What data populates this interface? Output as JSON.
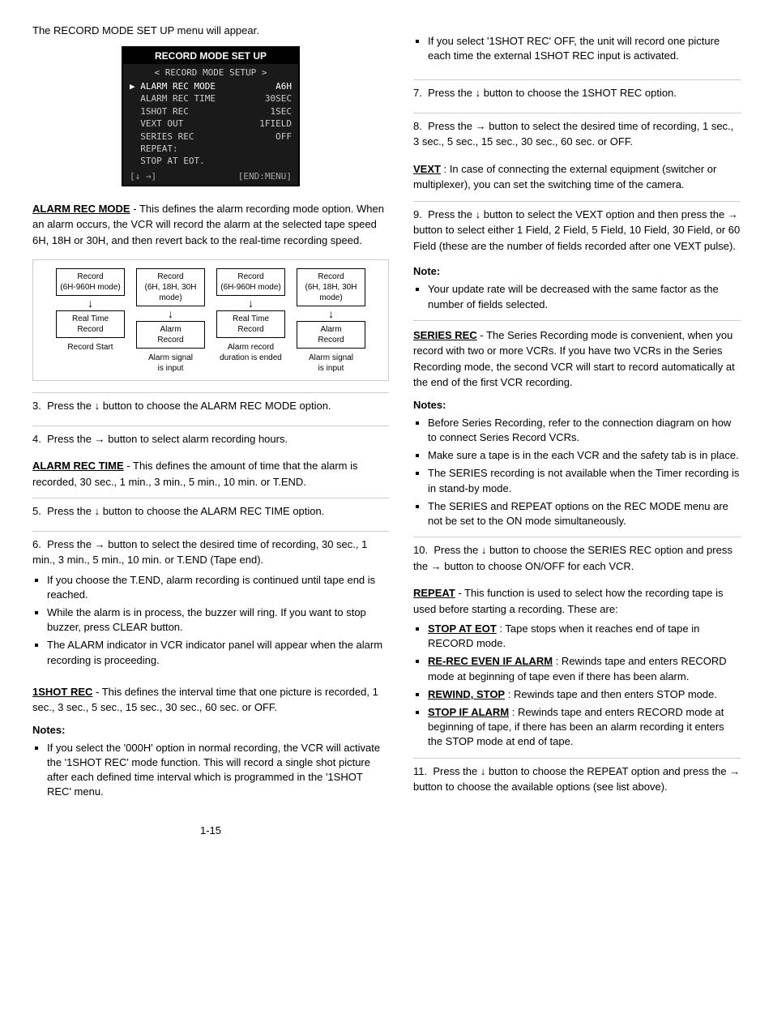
{
  "page": {
    "intro": "The RECORD MODE SET UP menu will appear.",
    "menu": {
      "title": "RECORD MODE SET UP",
      "header": "< RECORD MODE SETUP >",
      "rows": [
        {
          "label": "▶ ALARM REC MODE",
          "value": "A6H",
          "active": true
        },
        {
          "label": "  ALARM REC TIME",
          "value": "30SEC",
          "active": false
        },
        {
          "label": "  1SHOT REC",
          "value": "1SEC",
          "active": false
        },
        {
          "label": "  VEXT OUT",
          "value": "1FIELD",
          "active": false
        },
        {
          "label": "  SERIES REC",
          "value": "OFF",
          "active": false
        },
        {
          "label": "  REPEAT:",
          "value": "",
          "active": false
        },
        {
          "label": "  STOP AT EOT.",
          "value": "",
          "active": false
        }
      ],
      "footer_left": "[↓ →]",
      "footer_right": "[END:MENU]"
    },
    "diagram": {
      "columns": [
        {
          "top_box": "Record\n(6H-960H mode)",
          "sub_box": "Real Time\nRecord",
          "label": "Record Start"
        },
        {
          "top_box": "Record\n(6H, 18H, 30H\nmode)",
          "sub_box": "Alarm\nRecord",
          "label": "Alarm signal\nis input"
        },
        {
          "top_box": "Record\n(6H-960H mode)",
          "sub_box": "Real Time\nRecord",
          "label": "Alarm record\nduration is ended"
        },
        {
          "top_box": "Record\n(6H, 18H, 30H\nmode)",
          "sub_box": "Alarm\nRecord",
          "label": "Alarm signal\nis input"
        }
      ]
    },
    "left_sections": [
      {
        "id": "alarm_rec_mode",
        "term": "ALARM REC MODE",
        "body": "- This defines the alarm recording mode option.  When an alarm occurs, the VCR will record the alarm at the selected tape speed 6H, 18H or 30H, and then revert back to the real-time recording speed."
      },
      {
        "id": "alarm_rec_time",
        "term": "ALARM REC TIME",
        "body": "- This defines the amount of time that the alarm is recorded, 30 sec., 1 min., 3 min., 5 min., 10 min. or T.END."
      },
      {
        "id": "1shot_rec",
        "term": "1SHOT REC",
        "body": "- This defines the interval time that one picture is recorded, 1 sec., 3 sec., 5 sec., 15 sec., 30 sec., 60 sec. or OFF."
      }
    ],
    "steps_left": [
      {
        "num": "3.",
        "text": "Press the ↓ button to choose the ALARM REC MODE option."
      },
      {
        "num": "4.",
        "text": "Press the → button to select alarm recording hours."
      },
      {
        "num": "5.",
        "text": "Press the ↓ button to choose the ALARM REC TIME option."
      },
      {
        "num": "6.",
        "text": "Press the → button to select the desired time of recording, 30 sec., 1 min., 3 min., 5 min., 10 min. or T.END (Tape end)."
      }
    ],
    "bullets_step6": [
      "If you choose the T.END, alarm recording is continued until tape end is reached.",
      "While the alarm is in process, the buzzer will ring. If you want to stop buzzer, press CLEAR button.",
      "The ALARM indicator in VCR indicator panel will appear when the alarm recording is proceeding."
    ],
    "notes_1shot": {
      "title": "Notes:",
      "items": [
        "If you select the '000H' option in normal recording, the VCR will activate the '1SHOT REC' mode function. This will record a single shot picture after each defined time interval which is programmed in the '1SHOT REC' menu.",
        "If you select '1SHOT REC' OFF, the unit will record one picture each time the external 1SHOT REC input is activated."
      ]
    },
    "page_number": "1-15",
    "right_sections": [
      {
        "step_num": "7.",
        "text": "Press the ↓ button to choose the 1SHOT REC option."
      },
      {
        "step_num": "8.",
        "text": "Press the → button to select the desired time of recording, 1 sec., 3 sec., 5 sec., 15 sec., 30 sec., 60 sec. or OFF."
      }
    ],
    "vext_section": {
      "term": "VEXT",
      "body": ": In case of connecting the external equipment (switcher or multiplexer), you can set the switching time of the camera."
    },
    "step9": {
      "num": "9.",
      "text": "Press the ↓ button to select the VEXT option and then press the → button to select either 1 Field, 2 Field, 5 Field, 10 Field, 30 Field, or 60 Field (these are the number of fields recorded after one VEXT pulse)."
    },
    "note_vext": {
      "title": "Note:",
      "items": [
        "Your update rate will be decreased with the same factor as the number of fields selected."
      ]
    },
    "series_rec": {
      "term": "SERIES REC",
      "body": "- The Series Recording mode is convenient, when you record with two or more VCRs. If you have two VCRs in the Series Recording mode, the second VCR will start to record automatically at the end of the first VCR recording."
    },
    "notes_series": {
      "title": "Notes:",
      "items": [
        "Before Series Recording, refer to the connection diagram on how to connect Series Record VCRs.",
        "Make sure a tape is in the each VCR and the safety tab is in place.",
        "The SERIES recording is not available when the Timer recording is in stand-by mode.",
        "The SERIES and REPEAT options on the REC MODE menu are not be set to the ON mode simultaneously."
      ]
    },
    "step10": {
      "num": "10.",
      "text": "Press the ↓ button to choose the SERIES REC option and press the → button to choose ON/OFF for each VCR."
    },
    "repeat_section": {
      "term": "REPEAT",
      "body": "- This function is used to select how the recording tape is used before starting a recording.  These are:",
      "items": [
        {
          "term": "STOP AT EOT",
          "body": ": Tape stops when it reaches end of tape in RECORD mode."
        },
        {
          "term": "RE-REC EVEN IF ALARM",
          "body": ": Rewinds tape and enters RECORD mode at beginning of tape even if there has been alarm."
        },
        {
          "term": "REWIND, STOP",
          "body": ": Rewinds tape and then enters STOP mode."
        },
        {
          "term": "STOP IF ALARM",
          "body": ": Rewinds tape and enters RECORD mode at beginning of tape, if there has been an alarm recording it enters the STOP mode at end of tape."
        }
      ]
    },
    "step11": {
      "num": "11.",
      "text": "Press the ↓ button to choose the REPEAT option and press the → button to choose the available options (see list above)."
    }
  }
}
